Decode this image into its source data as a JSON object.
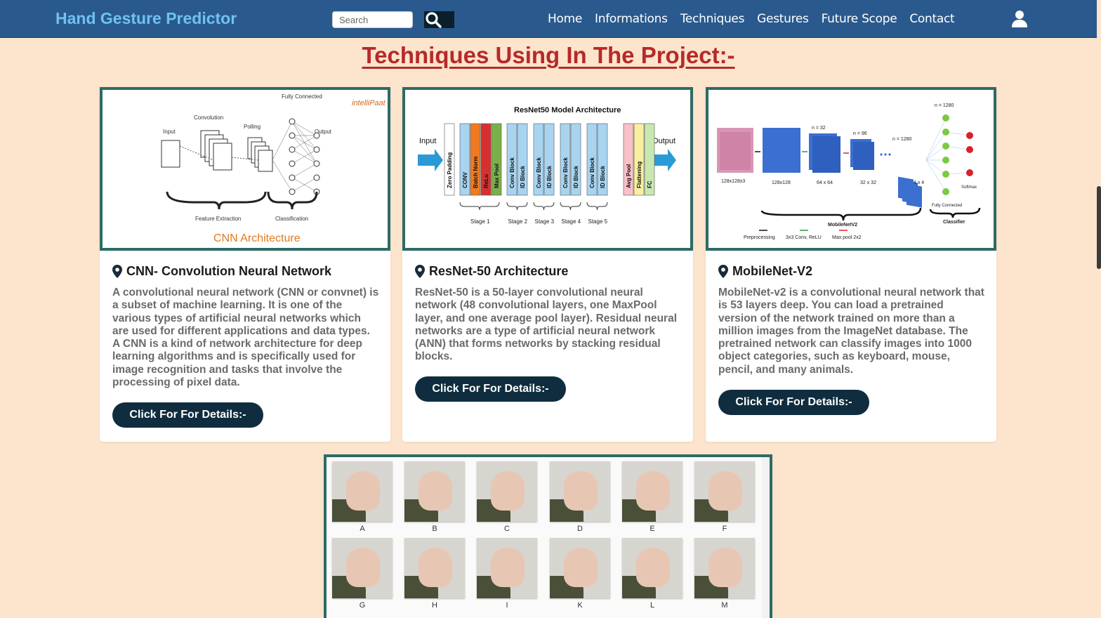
{
  "nav": {
    "brand": "Hand Gesture Predictor",
    "search_placeholder": "Search",
    "links": [
      "Home",
      "Informations",
      "Techniques",
      "Gestures",
      "Future Scope",
      "Contact"
    ]
  },
  "page_title": "Techniques Using In The Project:-",
  "cards": [
    {
      "title": "CNN- Convolution Neural Network",
      "text": "A convolutional neural network (CNN or convnet) is a subset of machine learning. It is one of the various types of artificial neural networks which are used for different applications and data types. A CNN is a kind of network architecture for deep learning algorithms and is specifically used for image recognition and tasks that involve the processing of pixel data.",
      "button": "Click For For Details:-",
      "image": {
        "caption": "CNN Architecture",
        "labels": [
          "Input",
          "Convolution",
          "Polling",
          "Fully Connected",
          "Output",
          "Feature Extraction",
          "Classification"
        ],
        "logo": "intelliPaat"
      }
    },
    {
      "title": "ResNet-50 Architecture",
      "text": "ResNet-50 is a 50-layer convolutional neural network (48 convolutional layers, one MaxPool layer, and one average pool layer). Residual neural networks are a type of artificial neural network (ANN) that forms networks by stacking residual blocks.",
      "button": "Click For For Details:-",
      "image": {
        "heading": "ResNet50 Model Architecture",
        "input": "Input",
        "output": "Output",
        "blocks": [
          "Zero Padding",
          "CONV",
          "Batch Norm",
          "ReLu",
          "Max Pool",
          "Conv Block",
          "ID Block",
          "Conv Block",
          "ID Block",
          "Conv Block",
          "ID Block",
          "Conv Block",
          "ID Block",
          "Avg Pool",
          "Flattening",
          "FC"
        ],
        "stages": [
          "Stage 1",
          "Stage 2",
          "Stage 3",
          "Stage 4",
          "Stage 5"
        ]
      }
    },
    {
      "title": "MobileNet-V2",
      "text": "MobileNet-v2 is a convolutional neural network that is 53 layers deep. You can load a pretrained version of the network trained on more than a million images from the ImageNet database. The pretrained network can classify images into 1000 object categories, such as keyboard, mouse, pencil, and many animals.",
      "button": "Click For For Details:-",
      "image": {
        "sizes": [
          "128x128x3",
          "128x128",
          "64 x 64",
          "32 x 32",
          "4 x 4"
        ],
        "n_labels": [
          "n = 32",
          "n = 96",
          "n = 1280",
          "n = 1280"
        ],
        "group_labels": [
          "MobileNetV2",
          "Classifier",
          "Fully Connected",
          "Softmax"
        ],
        "legend": [
          "Preprocessing",
          "3x3 Conv, ReLU",
          "Max pool 2x2"
        ]
      }
    }
  ],
  "gestures": [
    "A",
    "B",
    "C",
    "D",
    "E",
    "F",
    "G",
    "H",
    "I",
    "K",
    "L",
    "M"
  ],
  "colors": {
    "page_bg": "#fde4cc",
    "navbar": "#2a5a8d",
    "brand": "#6fc2f0",
    "title_red": "#b52a2a",
    "card_border": "#2d6b66",
    "button": "#0f2d3f"
  }
}
